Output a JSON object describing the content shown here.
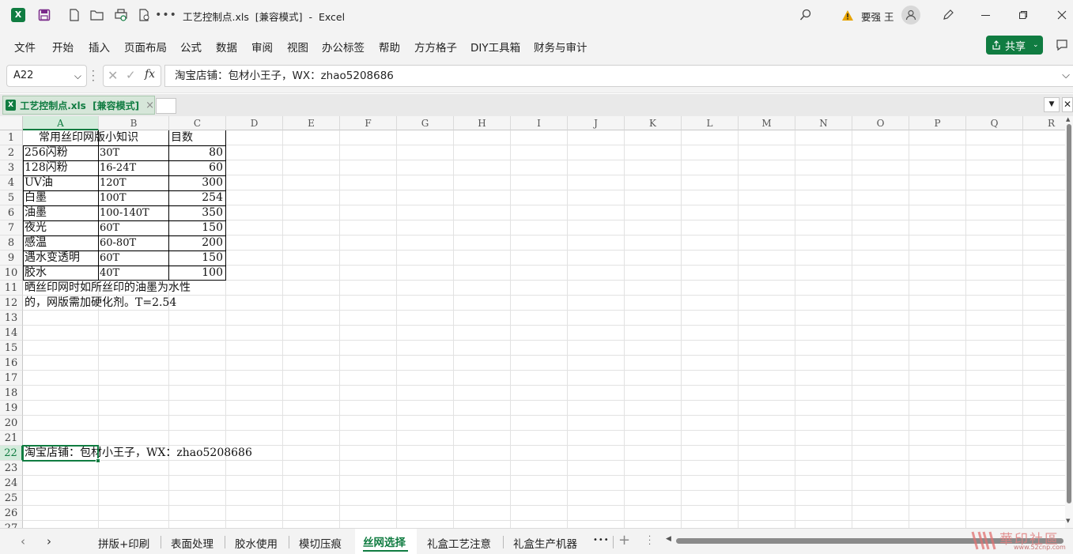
{
  "titlebar": {
    "doc_title": "工艺控制点.xls  [兼容模式]  -  Excel",
    "user_name": "要强 王"
  },
  "ribbon": {
    "tabs": [
      "文件",
      "开始",
      "插入",
      "页面布局",
      "公式",
      "数据",
      "审阅",
      "视图",
      "办公标签",
      "帮助",
      "方方格子",
      "DIY工具箱",
      "财务与审计"
    ],
    "share_label": "共享"
  },
  "formula_bar": {
    "name_box": "A22",
    "fx": "fx",
    "content": "淘宝店铺：包材小王子，WX：zhao5208686"
  },
  "workbook_tab": {
    "label": "工艺控制点.xls  [兼容模式]",
    "close": "×"
  },
  "columns": [
    "A",
    "B",
    "C",
    "D",
    "E",
    "F",
    "G",
    "H",
    "I",
    "J",
    "K",
    "L",
    "M",
    "N",
    "O",
    "P",
    "Q",
    "R"
  ],
  "rows": [
    "1",
    "2",
    "3",
    "4",
    "5",
    "6",
    "7",
    "8",
    "9",
    "10",
    "11",
    "12",
    "13",
    "14",
    "15",
    "16",
    "17",
    "18",
    "19",
    "20",
    "21",
    "22",
    "23",
    "24",
    "25",
    "26",
    "27"
  ],
  "cells": {
    "a1": "常用丝印网版小知识",
    "c1": "目数",
    "table": [
      {
        "a": "256闪粉",
        "b": "30T",
        "c": "80"
      },
      {
        "a": "128闪粉",
        "b": "16-24T",
        "c": "60"
      },
      {
        "a": "UV油",
        "b": "120T",
        "c": "300"
      },
      {
        "a": "白墨",
        "b": "100T",
        "c": "254"
      },
      {
        "a": "油墨",
        "b": "100-140T",
        "c": "350"
      },
      {
        "a": "夜光",
        "b": "60T",
        "c": "150"
      },
      {
        "a": "感温",
        "b": "60-80T",
        "c": "200"
      },
      {
        "a": "遇水变透明",
        "b": "60T",
        "c": "150"
      },
      {
        "a": "胶水",
        "b": "40T",
        "c": "100"
      }
    ],
    "a11": "晒丝印网时如所丝印的油墨为水性",
    "a12": "的，网版需加硬化剂。T=2.54",
    "a22": "淘宝店铺：包材小王子，WX：zhao5208686"
  },
  "sheet_tabs": [
    "拼版+印刷",
    "表面处理",
    "胶水使用",
    "模切压痕",
    "丝网选择",
    "礼盒工艺注意",
    "礼盒生产机器"
  ],
  "active_sheet": "丝网选择",
  "more": "•••",
  "add": "+",
  "watermark": {
    "text": "華印社區",
    "url": "www.52cnp.com"
  },
  "colors": {
    "excel_green": "#107c41",
    "active_tab_underline": "#107c41"
  }
}
